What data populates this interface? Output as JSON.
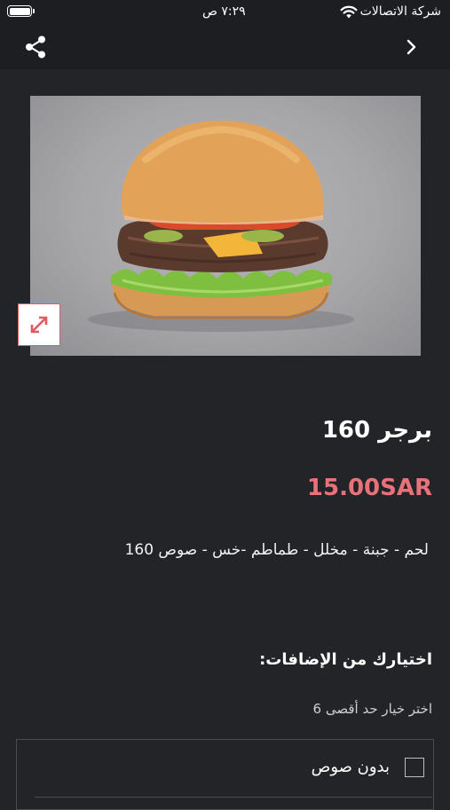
{
  "status_bar": {
    "carrier": "شركة الاتصالات",
    "time": "٧:٢٩ ص"
  },
  "nav": {
    "share_icon": "share-icon",
    "back_icon": "chevron-right-icon"
  },
  "product": {
    "image_alt": "burger-photo",
    "expand_icon": "expand-icon",
    "title": "برجر 160",
    "price": "15.00SAR",
    "description": "لحم - جبنة - مخلل - طماطم -خس - صوص 160"
  },
  "addons": {
    "heading": "اختيارك من الإضافات:",
    "hint": "اختر خيار حد أقصى 6",
    "options": [
      {
        "label": "بدون صوص",
        "checked": false
      }
    ]
  },
  "colors": {
    "background": "#232427",
    "bar": "#1d1e21",
    "price": "#e8717a",
    "expand_border": "#e05a5f"
  }
}
